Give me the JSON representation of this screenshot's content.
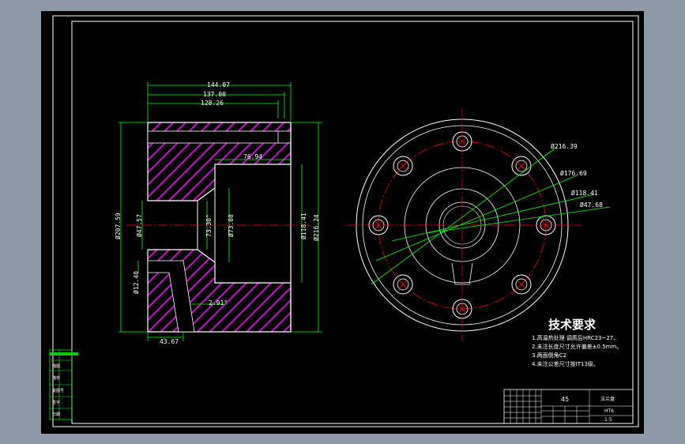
{
  "colors": {
    "background": "#000000",
    "frame": "#ffffff",
    "hatch": "#ff00ff",
    "dimension": "#00ff00",
    "centerline": "#ff0000",
    "text": "#ffffff"
  },
  "section_view": {
    "dimensions": {
      "top_overall": "144.07",
      "top_mid": "137.00",
      "top_inner": "128.26",
      "bore_depth": "76.94",
      "dia_outer": "Ø207.59",
      "dia_small_bore": "Ø47.57",
      "chamfer_angle": "73.30°",
      "dia_bore": "Ø73.08",
      "dia_counterbore": "Ø118.41",
      "dia_flange": "Ø216.24",
      "dia_hole": "Ø12.40",
      "taper_angle": "2.91°",
      "hole_offset": "43.67"
    }
  },
  "front_view": {
    "dimensions": {
      "d1": "Ø216.39",
      "d2": "Ø176.69",
      "d3": "Ø118.41",
      "d4": "Ø47.68"
    }
  },
  "tech_requirements": {
    "title": "技术要求",
    "notes": [
      "1.高温热处理  调质后HRC23~27。",
      "2.未注长度尺寸允许偏差±0.5mm。",
      "3.两面倒角C2",
      "4.未注公差尺寸按IT13级。"
    ]
  },
  "title_block": {
    "material": "45",
    "name": "法兰盘",
    "code": "HT6",
    "scale": "1:5"
  },
  "left_table": {
    "rows": [
      "描图",
      "描校",
      "底图号",
      "签字",
      "日期"
    ]
  }
}
